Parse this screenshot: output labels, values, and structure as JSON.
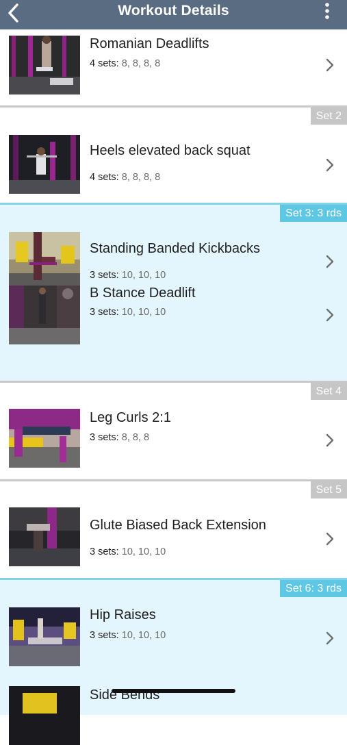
{
  "header": {
    "title": "Workout Details",
    "back_icon": "chevron-left-icon",
    "menu_icon": "more-vertical-icon"
  },
  "colors": {
    "header_bg": "#5a6c82",
    "circuit_bg": "#e4f6fd",
    "circuit_badge": "#5ec8e4",
    "set_badge": "#c6c6c6"
  },
  "sections": [
    {
      "badge": "",
      "exercises": [
        {
          "name": "Romanian Deadlifts",
          "sets_label": "4 sets:",
          "reps": "8, 8, 8, 8"
        }
      ]
    },
    {
      "badge": "Set 2",
      "exercises": [
        {
          "name": "Heels elevated back squat",
          "sets_label": "4 sets:",
          "reps": "8, 8, 8, 8"
        }
      ]
    },
    {
      "badge": "Set 3: 3 rds",
      "exercises": [
        {
          "name": "Standing Banded Kickbacks",
          "sets_label": "3 sets:",
          "reps": "10, 10, 10"
        },
        {
          "name": "B Stance Deadlift",
          "sets_label": "3 sets:",
          "reps": "10, 10, 10"
        }
      ]
    },
    {
      "badge": "Set 4",
      "exercises": [
        {
          "name": "Leg Curls 2:1",
          "sets_label": "3 sets:",
          "reps": "8, 8, 8"
        }
      ]
    },
    {
      "badge": "Set 5",
      "exercises": [
        {
          "name": "Glute Biased Back Extension",
          "sets_label": "3 sets:",
          "reps": "10, 10, 10"
        }
      ]
    },
    {
      "badge": "Set 6: 3 rds",
      "exercises": [
        {
          "name": "Hip Raises",
          "sets_label": "3 sets:",
          "reps": "10, 10, 10"
        },
        {
          "name": "Side Bends",
          "sets_label": "",
          "reps": ""
        }
      ]
    }
  ]
}
